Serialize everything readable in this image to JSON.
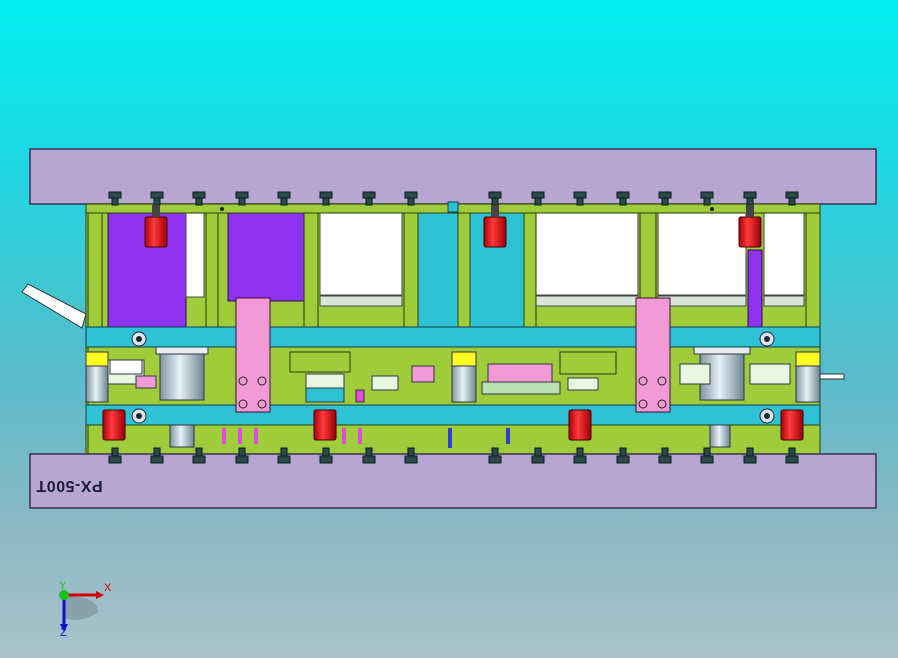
{
  "drawing": {
    "plate_label": "PX-500T",
    "colors": {
      "plate": "#b7a6d2",
      "plate_edge": "#3b2f55",
      "frame": "#9fcc3a",
      "frame_edge": "#27410a",
      "blue_plate": "#2fc2d4",
      "purple_block": "#9033ee",
      "white_block": "#ffffff",
      "pink_block": "#f29ad6",
      "red_cyl": "#e0121a",
      "yellow": "#ffff22",
      "guide": "#b9d0dc"
    }
  },
  "axes": {
    "x_label": "X",
    "y_label": "Y",
    "z_label": "Z"
  }
}
